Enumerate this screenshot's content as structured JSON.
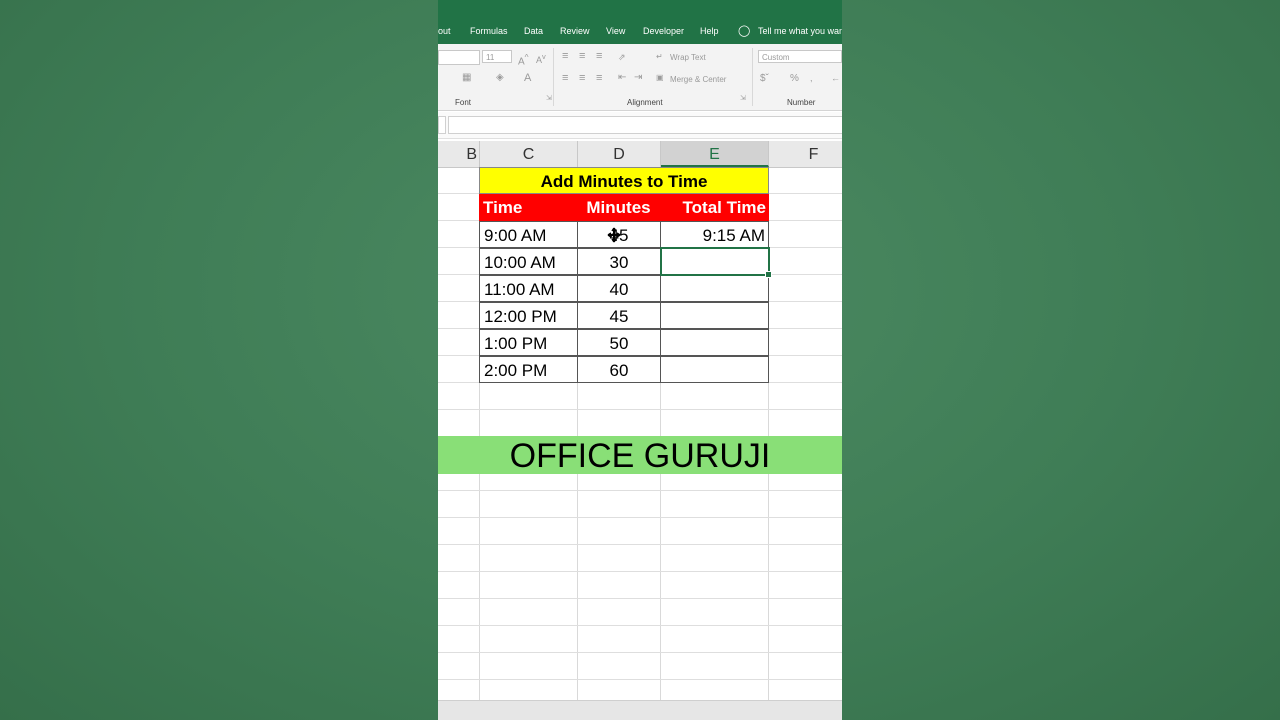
{
  "ribbon_tabs": [
    "out",
    "Formulas",
    "Data",
    "Review",
    "View",
    "Developer",
    "Help",
    "Tell me what you want"
  ],
  "ribbon": {
    "font_size": "11",
    "wrap_text": "Wrap Text",
    "merge_center": "Merge & Center",
    "number_format": "Custom",
    "groups": {
      "font": "Font",
      "alignment": "Alignment",
      "number": "Number"
    }
  },
  "columns": [
    "B",
    "C",
    "D",
    "E",
    "F"
  ],
  "selected_column": "E",
  "table": {
    "title": "Add Minutes to Time",
    "headers": [
      "Time",
      "Minutes",
      "Total Time"
    ],
    "rows": [
      {
        "time": "9:00 AM",
        "minutes": "45",
        "total": "9:15 AM"
      },
      {
        "time": "10:00 AM",
        "minutes": "30",
        "total": ""
      },
      {
        "time": "11:00 AM",
        "minutes": "40",
        "total": ""
      },
      {
        "time": "12:00 PM",
        "minutes": "45",
        "total": ""
      },
      {
        "time": "1:00 PM",
        "minutes": "50",
        "total": ""
      },
      {
        "time": "2:00 PM",
        "minutes": "60",
        "total": ""
      }
    ]
  },
  "banner": "OFFICE GURUJI",
  "colors": {
    "excel_green": "#217346",
    "title_fill": "#ffff00",
    "header_fill": "#ff0000",
    "banner_fill": "#89df77"
  }
}
